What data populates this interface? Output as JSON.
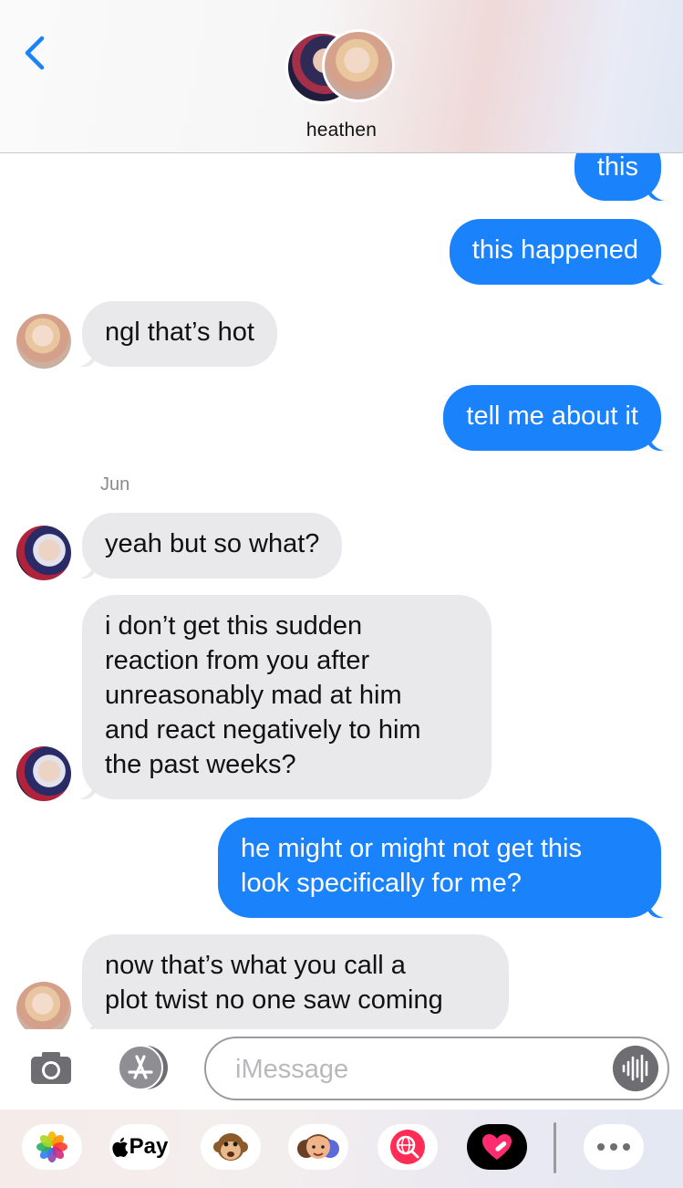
{
  "header": {
    "contact_name": "heathen"
  },
  "messages": [
    {
      "direction": "sent",
      "text": "this"
    },
    {
      "direction": "sent",
      "text": "this happened"
    },
    {
      "direction": "received",
      "sender": "heathen",
      "text": "ngl that’s hot"
    },
    {
      "direction": "sent",
      "text": "tell me about it"
    },
    {
      "direction": "received",
      "sender": "Jun",
      "sender_label": "Jun",
      "text": "yeah but so what?"
    },
    {
      "direction": "received",
      "sender": "Jun",
      "text": "i don’t get this sudden\nreaction from you after\nunreasonably mad at him\nand react negatively to him\nthe past weeks?"
    },
    {
      "direction": "sent",
      "text": "he might or might not get this\nlook specifically for me?"
    },
    {
      "direction": "received",
      "sender": "heathen",
      "text": "now that’s what you call a\nplot twist no one saw coming"
    }
  ],
  "input": {
    "placeholder": "iMessage",
    "value": ""
  },
  "app_drawer": {
    "apps": [
      "photos-icon",
      "apple-pay-icon",
      "animoji-icon",
      "memoji-icon",
      "gif-search-icon",
      "digital-touch-icon",
      "more-apps-icon"
    ],
    "pay_label": "Pay"
  },
  "colors": {
    "sent_bubble": "#1a82fb",
    "received_bubble": "#e9e9eb",
    "accent": "#1a82fb"
  }
}
